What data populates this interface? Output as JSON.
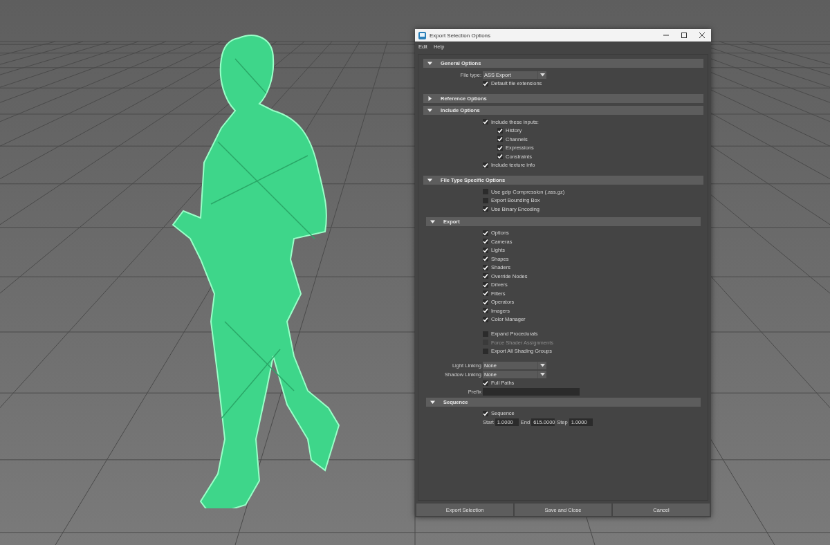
{
  "window": {
    "title": "Export Selection Options"
  },
  "menu": [
    "Edit",
    "Help"
  ],
  "sections": [
    {
      "title": "General Options",
      "expanded": true,
      "groups": [
        [
          {
            "kind": "dropdown",
            "label": "File type:",
            "value": "ASS Export"
          },
          {
            "kind": "checkbox",
            "label": "Default file extensions",
            "checked": true,
            "disabled": false
          }
        ]
      ]
    },
    {
      "title": "Reference Options",
      "expanded": false
    },
    {
      "title": "Include Options",
      "expanded": true,
      "groups": [
        [
          {
            "kind": "checkbox",
            "label": "Include these inputs:",
            "checked": true,
            "disabled": false,
            "children": [
              {
                "kind": "checkbox",
                "label": "History",
                "checked": true,
                "disabled": false
              },
              {
                "kind": "checkbox",
                "label": "Channels",
                "checked": true,
                "disabled": false
              },
              {
                "kind": "checkbox",
                "label": "Expressions",
                "checked": true,
                "disabled": false
              },
              {
                "kind": "checkbox",
                "label": "Constraints",
                "checked": true,
                "disabled": false
              }
            ]
          },
          {
            "kind": "checkbox",
            "label": "Include texture info",
            "checked": true,
            "disabled": false
          }
        ]
      ]
    },
    {
      "title": "File Type Specific Options",
      "expanded": true,
      "groups": [
        [
          {
            "kind": "checkbox",
            "label": "Use gzip Compression (.ass.gz)",
            "checked": false,
            "disabled": false
          },
          {
            "kind": "checkbox",
            "label": "Export Bounding Box",
            "checked": false,
            "disabled": false
          },
          {
            "kind": "checkbox",
            "label": "Use Binary Encoding",
            "checked": true,
            "disabled": false
          }
        ]
      ],
      "subsections": [
        {
          "title": "Export",
          "expanded": true,
          "groups": [
            [
              {
                "kind": "checkbox",
                "label": "Options",
                "checked": true,
                "disabled": false
              },
              {
                "kind": "checkbox",
                "label": "Cameras",
                "checked": true,
                "disabled": false
              },
              {
                "kind": "checkbox",
                "label": "Lights",
                "checked": true,
                "disabled": false
              },
              {
                "kind": "checkbox",
                "label": "Shapes",
                "checked": true,
                "disabled": false
              },
              {
                "kind": "checkbox",
                "label": "Shaders",
                "checked": true,
                "disabled": false
              },
              {
                "kind": "checkbox",
                "label": "Override Nodes",
                "checked": true,
                "disabled": false
              },
              {
                "kind": "checkbox",
                "label": "Drivers",
                "checked": true,
                "disabled": false
              },
              {
                "kind": "checkbox",
                "label": "Filters",
                "checked": true,
                "disabled": false
              },
              {
                "kind": "checkbox",
                "label": "Operators",
                "checked": true,
                "disabled": false
              },
              {
                "kind": "checkbox",
                "label": "Imagers",
                "checked": true,
                "disabled": false
              },
              {
                "kind": "checkbox",
                "label": "Color Manager",
                "checked": true,
                "disabled": false
              }
            ],
            [
              {
                "kind": "checkbox",
                "label": "Expand Procedurals",
                "checked": false,
                "disabled": false
              },
              {
                "kind": "checkbox",
                "label": "Force Shader Assignments",
                "checked": false,
                "disabled": true
              },
              {
                "kind": "checkbox",
                "label": "Export All Shading Groups",
                "checked": false,
                "disabled": false
              }
            ],
            [
              {
                "kind": "dropdown",
                "label": "Light Linking",
                "value": "None"
              },
              {
                "kind": "dropdown",
                "label": "Shadow Linking",
                "value": "None"
              },
              {
                "kind": "checkbox",
                "label": "Full Paths",
                "checked": true,
                "disabled": false
              },
              {
                "kind": "field",
                "label": "Prefix"
              }
            ]
          ]
        },
        {
          "title": "Sequence",
          "expanded": true,
          "groups": [
            [
              {
                "kind": "checkbox",
                "label": "Sequence",
                "checked": true,
                "disabled": false
              },
              {
                "kind": "range",
                "fields": [
                  {
                    "label": "Start",
                    "value": "1.0000"
                  },
                  {
                    "label": "End",
                    "value": "615.0000"
                  },
                  {
                    "label": "Step",
                    "value": "1.0000"
                  }
                ]
              }
            ]
          ]
        }
      ]
    }
  ],
  "buttons": [
    "Export Selection",
    "Save and Close",
    "Cancel"
  ]
}
